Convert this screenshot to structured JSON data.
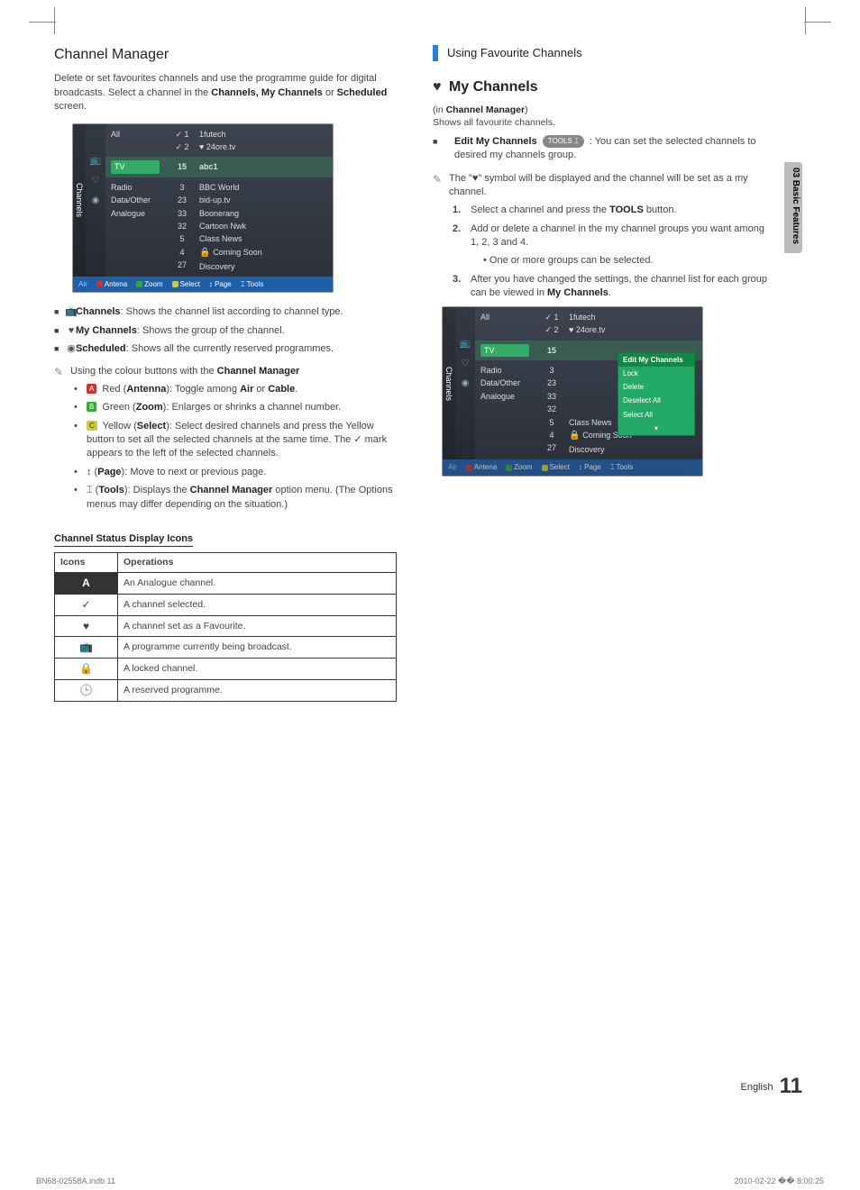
{
  "section_tab": "03  Basic Features",
  "left": {
    "title": "Channel Manager",
    "intro_a": "Delete or set favourites channels and use the programme guide for digital broadcasts. Select a channel in the ",
    "intro_b": "Channels, My Channels",
    "intro_c": " or ",
    "intro_d": "Scheduled",
    "intro_e": " screen.",
    "tv1": {
      "side": "Channels",
      "types": [
        "All",
        "TV",
        "Radio",
        "Data/Other",
        "Analogue"
      ],
      "top_checks": [
        "1",
        "2"
      ],
      "top_names": [
        "1futech",
        "24ore.tv"
      ],
      "sel_num": "15",
      "sel_name": "abc1",
      "nums": [
        "3",
        "23",
        "33",
        "32",
        "5",
        "4",
        "27"
      ],
      "names": [
        "BBC World",
        "bid-up.tv",
        "Boonerang",
        "Cartoon Nwk",
        "Class News",
        "Coming Soon",
        "Discovery"
      ],
      "bar_air": "Air",
      "bar_items": [
        "Antena",
        "Zoom",
        "Select",
        "Page",
        "Tools"
      ]
    },
    "bullets": [
      {
        "icon": "📺",
        "strong": "Channels",
        "rest": ": Shows the channel list according to channel type."
      },
      {
        "icon": "♥",
        "strong": "My Channels",
        "rest": ": Shows the group of the channel."
      },
      {
        "icon": "◉",
        "strong": "Scheduled",
        "rest": ": Shows all the currently reserved programmes."
      }
    ],
    "note_a": "Using the colour buttons with the ",
    "note_b": "Channel Manager",
    "colour_items": [
      {
        "tag": "A",
        "label": "Red",
        "strong": "Antenna",
        "rest": ": Toggle among ",
        "s2": "Air",
        "rest2": " or ",
        "s3": "Cable",
        "rest3": "."
      },
      {
        "tag": "B",
        "label": "Green",
        "strong": "Zoom",
        "rest": ": Enlarges or shrinks a channel number."
      },
      {
        "tag": "C",
        "label": "Yellow",
        "strong": "Select",
        "rest": ": Select desired channels and press the Yellow button to set all the selected channels at the same time. The ✓ mark appears to the left of the selected channels."
      },
      {
        "tag": "↕",
        "label": "",
        "strong": "Page",
        "rest": ": Move to next or previous page."
      },
      {
        "tag": "⌶",
        "label": "",
        "strong": "Tools",
        "rest": ": Displays the ",
        "s2": "Channel Manager",
        "rest2": " option menu. (The Options menus may differ depending on the situation.)"
      }
    ],
    "status_title": "Channel Status Display Icons",
    "status_table_headers": [
      "Icons",
      "Operations"
    ],
    "status_rows": [
      {
        "icon": "A",
        "op": "An Analogue channel."
      },
      {
        "icon": "✓",
        "op": "A channel selected."
      },
      {
        "icon": "♥",
        "op": "A channel set as a Favourite."
      },
      {
        "icon": "📺",
        "op": "A programme currently being broadcast."
      },
      {
        "icon": "🔒",
        "op": "A locked channel."
      },
      {
        "icon": "🕒",
        "op": "A reserved programme."
      }
    ]
  },
  "right": {
    "subhead": "Using Favourite Channels",
    "mych_title": "My Channels",
    "in_line_a": "(in ",
    "in_line_b": "Channel Manager",
    "in_line_c": ")",
    "shows": "Shows all favourite channels.",
    "edit_strong": "Edit My Channels",
    "tools_badge": "TOOLS ⌶",
    "edit_rest": " : You can set the selected channels to desired my channels group.",
    "note1_a": "The \"",
    "note1_b": "♥",
    "note1_c": "\" symbol will be displayed and the channel will be set as a my channel.",
    "steps": [
      {
        "n": "1.",
        "txt_a": "Select a channel and press the ",
        "s": "TOOLS",
        "txt_b": " button."
      },
      {
        "n": "2.",
        "txt_a": "Add or delete a channel in the my channel groups you want among 1, 2, 3 and 4.",
        "sub": "One or more groups can be selected."
      },
      {
        "n": "3.",
        "txt_a": "After you have changed the settings, the channel list for each group can be viewed in ",
        "s": "My Channels",
        "txt_b": "."
      }
    ],
    "tv2": {
      "side": "Channels",
      "types": [
        "All",
        "TV",
        "Radio",
        "Data/Other",
        "Analogue"
      ],
      "top_checks": [
        "1",
        "2"
      ],
      "top_names": [
        "1futech",
        "24ore.tv"
      ],
      "sel_num": "15",
      "popup_title": "Edit My Channels",
      "popup_items": [
        "Lock",
        "Delete",
        "Deselect All",
        "Select All"
      ],
      "nums": [
        "3",
        "23",
        "33",
        "32",
        "5",
        "4",
        "27"
      ],
      "tail_names": [
        "Class News",
        "Coming Soon",
        "Discovery"
      ],
      "bar_air": "Air",
      "bar_items": [
        "Antena",
        "Zoom",
        "Select",
        "Page",
        "Tools"
      ]
    }
  },
  "chart_data": {
    "type": "table",
    "title": "Channel Status Display Icons",
    "columns": [
      "Icons",
      "Operations"
    ],
    "rows": [
      [
        "A",
        "An Analogue channel."
      ],
      [
        "✓",
        "A channel selected."
      ],
      [
        "♥",
        "A channel set as a Favourite."
      ],
      [
        "📺",
        "A programme currently being broadcast."
      ],
      [
        "🔒",
        "A locked channel."
      ],
      [
        "🕒",
        "A reserved programme."
      ]
    ]
  },
  "footer_lang": "English",
  "footer_page": "11",
  "imprint_left": "BN68-02558A.indb   11",
  "imprint_right": "2010-02-22   �� 8:00:25"
}
